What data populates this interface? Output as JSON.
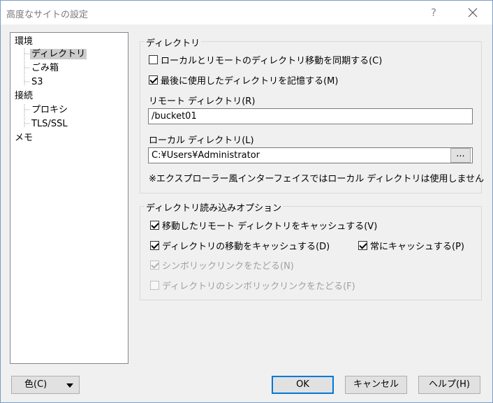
{
  "window": {
    "title": "高度なサイトの設定",
    "help_glyph": "?",
    "close_icon": "close-icon"
  },
  "tree": {
    "items": [
      {
        "label": "環境",
        "level": 0
      },
      {
        "label": "ディレクトリ",
        "level": 1,
        "selected": true
      },
      {
        "label": "ごみ箱",
        "level": 1
      },
      {
        "label": "S3",
        "level": 1
      },
      {
        "label": "接続",
        "level": 0
      },
      {
        "label": "プロキシ",
        "level": 1
      },
      {
        "label": "TLS/SSL",
        "level": 1
      },
      {
        "label": "メモ",
        "level": 0
      }
    ]
  },
  "directory_group": {
    "title": "ディレクトリ",
    "sync_checkbox": {
      "label": "ローカルとリモートのディレクトリ移動を同期する(C)",
      "checked": false
    },
    "remember_checkbox": {
      "label": "最後に使用したディレクトリを記憶する(M)",
      "checked": true
    },
    "remote_label": "リモート ディレクトリ(R)",
    "remote_value": "/bucket01",
    "local_label": "ローカル ディレクトリ(L)",
    "local_value": "C:¥Users¥Administrator",
    "browse_label": "...",
    "note": "※エクスプローラー風インターフェイスではローカル ディレクトリは使用しません"
  },
  "read_options_group": {
    "title": "ディレクトリ読み込みオプション",
    "cache_remote": {
      "label": "移動したリモート ディレクトリをキャッシュする(V)",
      "checked": true
    },
    "cache_move": {
      "label": "ディレクトリの移動をキャッシュする(D)",
      "checked": true
    },
    "always_cache": {
      "label": "常にキャッシュする(P)",
      "checked": true
    },
    "follow_symlinks": {
      "label": "シンボリックリンクをたどる(N)",
      "checked": true,
      "disabled": true
    },
    "follow_dir_symlinks": {
      "label": "ディレクトリのシンボリックリンクをたどる(F)",
      "checked": false,
      "disabled": true
    }
  },
  "footer": {
    "color_button": "色(C)",
    "ok": "OK",
    "cancel": "キャンセル",
    "help": "ヘルプ(H)"
  },
  "colors": {
    "accent": "#0078d7",
    "tree_selected": "#cccccc",
    "disabled_text": "#a0a0a0"
  }
}
